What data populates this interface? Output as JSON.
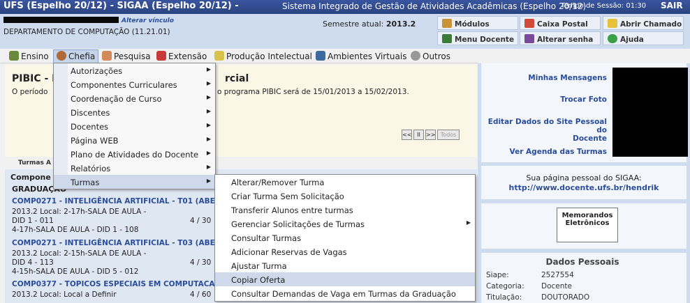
{
  "header": {
    "system_short": "UFS (Espelho 20/12) - SIGAA (Espelho 20/12) -",
    "system_name": "Sistema Integrado de Gestão de Atividades Acadêmicas (Espelho 20/12)",
    "timer": "Tempo de Sessão: 01:30",
    "logout": "SAIR"
  },
  "info": {
    "change_link": "Alterar vínculo",
    "department": "DEPARTAMENTO DE COMPUTAÇÃO (11.21.01)",
    "semester_label": "Semestre atual:",
    "semester_value": "2013.2"
  },
  "quick": {
    "modulos": "Módulos",
    "caixa_postal": "Caixa Postal",
    "abrir_chamado": "Abrir Chamado",
    "menu_docente": "Menu Docente",
    "alterar_senha": "Alterar senha",
    "ajuda": "Ajuda"
  },
  "menu": [
    "Ensino",
    "Chefia",
    "Pesquisa",
    "Extensão",
    "Produção Intelectual",
    "Ambientes Virtuais",
    "Outros"
  ],
  "notice": {
    "title_a": "PIBIC - I",
    "title_b": "rcial",
    "text_a": "O período",
    "text_b": "o programa PIBIC será de 15/01/2013 a 15/02/2013."
  },
  "pager": {
    "first": "<<",
    "pause": "II",
    "next": ">>",
    "all": "Todos"
  },
  "turmas": {
    "label": "Turmas A",
    "header": "Compone",
    "level": "GRADUAÇÃO",
    "courses": [
      {
        "code": "COMP0271 - INTELIGÊNCIA ARTIFICIAL - T01 (ABE",
        "l1": "2013.2 Local: 2-17h-SALA DE AULA -",
        "l2": "DID 1 - 011",
        "l3": "4-17h-SALA DE AULA - DID 1 - 108",
        "count": "4 / 30"
      },
      {
        "code": "COMP0271 - INTELIGÊNCIA ARTIFICIAL - T03 (ABE",
        "l1": "2013.2 Local: 2-15h-SALA DE AULA -",
        "l2": "DID 4 - 113",
        "l3": "4-15h-SALA DE AULA - DID 5 - 012",
        "count": "4 / 30"
      },
      {
        "code": "COMP0377 - TOPICOS ESPECIAIS EM COMPUTACAO",
        "l1": "2013.2 Local: Local a Definir",
        "count": "4 / 60"
      }
    ]
  },
  "chefia_menu": [
    "Autorizações",
    "Componentes Curriculares",
    "Coordenação de Curso",
    "Discentes",
    "Docentes",
    "Página WEB",
    "Plano de Atividades do Docente",
    "Relatórios",
    "Turmas"
  ],
  "turmas_menu": [
    "Alterar/Remover Turma",
    "Criar Turma Sem Solicitação",
    "Transferir Alunos entre turmas",
    "Gerenciar Solicitações de Turmas",
    "Consultar Turmas",
    "Adicionar Reservas de Vagas",
    "Ajustar Turma",
    "Copiar Oferta",
    "Consultar Demandas de Vaga em Turmas da Graduação"
  ],
  "right": {
    "msgs": "Minhas Mensagens",
    "foto": "Trocar Foto",
    "site_l1": "Editar Dados do Site Pessoal do",
    "site_l2": "Docente",
    "agenda": "Ver Agenda das Turmas",
    "page_label": "Sua página pessoal do SIGAA:",
    "page_url": "http://www.docente.ufs.br/hendrik",
    "memo_l1": "Memorandos",
    "memo_l2": "Eletrônicos",
    "dados_title": "Dados Pessoais",
    "siape_label": "Siape:",
    "siape": "2527554",
    "cat_label": "Categoria:",
    "cat": "Docente",
    "tit_label": "Titulação:",
    "tit": "DOUTORADO"
  },
  "colors": {
    "topbar": "#2a437f",
    "link": "#2a4d9b",
    "info_bg": "#cfdcef"
  }
}
